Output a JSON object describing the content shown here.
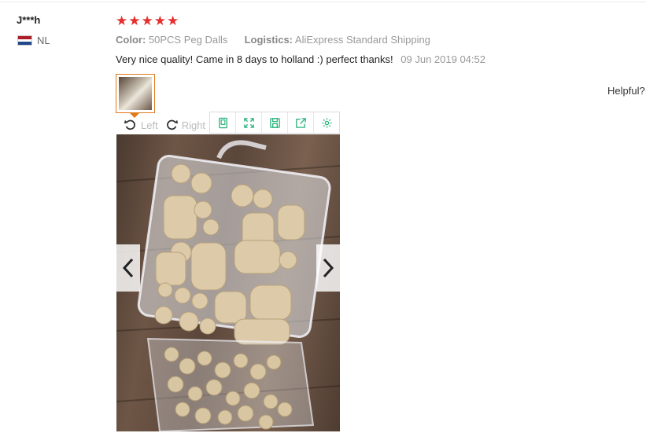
{
  "review": {
    "user_name": "J***h",
    "country_code": "NL",
    "flag_colors": [
      "#ae1c28",
      "#ffffff",
      "#21468b"
    ],
    "rating": 5,
    "star_glyph": "★",
    "star_color": "#e62e2e",
    "color_label": "Color:",
    "color_value": "50PCS Peg Dalls",
    "logistics_label": "Logistics:",
    "logistics_value": "AliExpress Standard Shipping",
    "text": "Very nice quality! Came in 8 days to holland :) perfect thanks!",
    "date": "09 Jun 2019 04:52",
    "helpful_label": "Helpful?"
  },
  "viewer": {
    "rotate_left_label": "Left",
    "rotate_right_label": "Right",
    "accent_color": "#2ab27b",
    "toolbar_icons": [
      "fit-icon",
      "fullscreen-icon",
      "save-icon",
      "share-icon",
      "settings-icon"
    ],
    "thumbnail_border_color": "#e07a1a"
  }
}
